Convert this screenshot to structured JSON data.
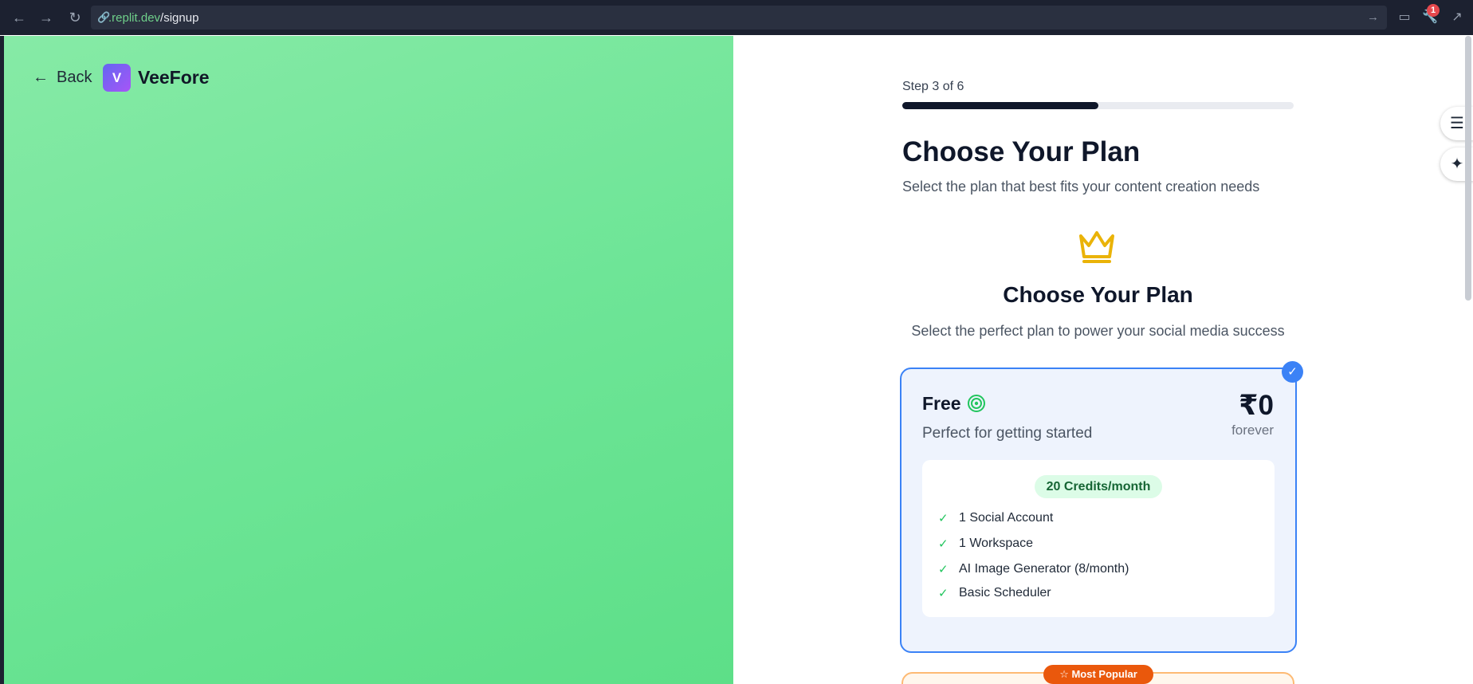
{
  "browser": {
    "url_host": ".replit.dev",
    "url_path": "/signup",
    "notification_count": "1",
    "icons": {
      "back": "arrow-left-icon",
      "forward": "arrow-right-icon",
      "reload": "reload-icon",
      "link": "link-icon",
      "go": "arrow-right-icon",
      "devices": "monitor-icon",
      "tools": "wrench-icon",
      "open_external": "external-link-icon"
    }
  },
  "left": {
    "back_label": "Back",
    "logo_letter": "V",
    "brand_name": "VeeFore",
    "gradient_colors": [
      "#86eaa6",
      "#5ddf88"
    ]
  },
  "onboarding": {
    "step_label": "Step 3 of 6",
    "progress_fraction": 0.5,
    "title": "Choose Your Plan",
    "subtitle": "Select the plan that best fits your content creation needs",
    "section_icon": "crown-icon",
    "section_title": "Choose Your Plan",
    "section_subtitle": "Select the perfect plan to power your social media success"
  },
  "plans": [
    {
      "name": "Free",
      "icon": "target-icon",
      "description": "Perfect for getting started",
      "price": "₹0",
      "period": "forever",
      "selected": true,
      "credits": "20 Credits/month",
      "features": [
        "1 Social Account",
        "1 Workspace",
        "AI Image Generator (8/month)",
        "Basic Scheduler"
      ]
    },
    {
      "badge": "☆ Most Popular"
    }
  ],
  "colors": {
    "accent_blue": "#3b82f6",
    "success_green": "#22c55e",
    "popular_orange": "#ea580c",
    "crown_gold": "#eab308"
  }
}
